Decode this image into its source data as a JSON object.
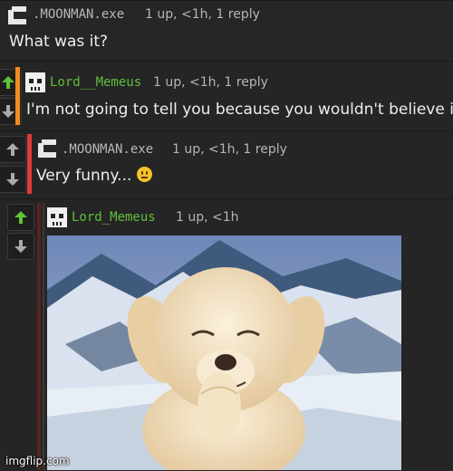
{
  "comments": [
    {
      "username": ".MOONMAN.exe",
      "meta": "1 up, <1h, 1 reply",
      "text": "What was it?"
    },
    {
      "username": "Lord__Memeus",
      "meta": "1 up, <1h, 1 reply",
      "text": "I'm not going to tell you because you wouldn't believe it."
    },
    {
      "username": ".MOONMAN.exe",
      "meta": "1 up, <1h, 1 reply",
      "text": "Very funny..."
    },
    {
      "username": "Lord_Memeus",
      "meta": "1 up, <1h",
      "text": ""
    }
  ],
  "colors": {
    "moonman_name": "#b8b8b8",
    "memeus_name": "#5fbf3a",
    "bar_orange": "#f28c1c",
    "bar_red": "#e23a3a",
    "bar_green": "#3fa52b",
    "upvote_active": "#5dc236"
  },
  "icons": {
    "moonman_avatar": "moonman-logo-icon",
    "memeus_avatar": "skull-icon",
    "upvote": "up-arrow-icon",
    "downvote": "down-arrow-icon",
    "emoji": "neutral-face-emoji-icon"
  },
  "image": {
    "description_alt": "laughing puppy in snowy mountains"
  },
  "watermark": "imgflip.com"
}
